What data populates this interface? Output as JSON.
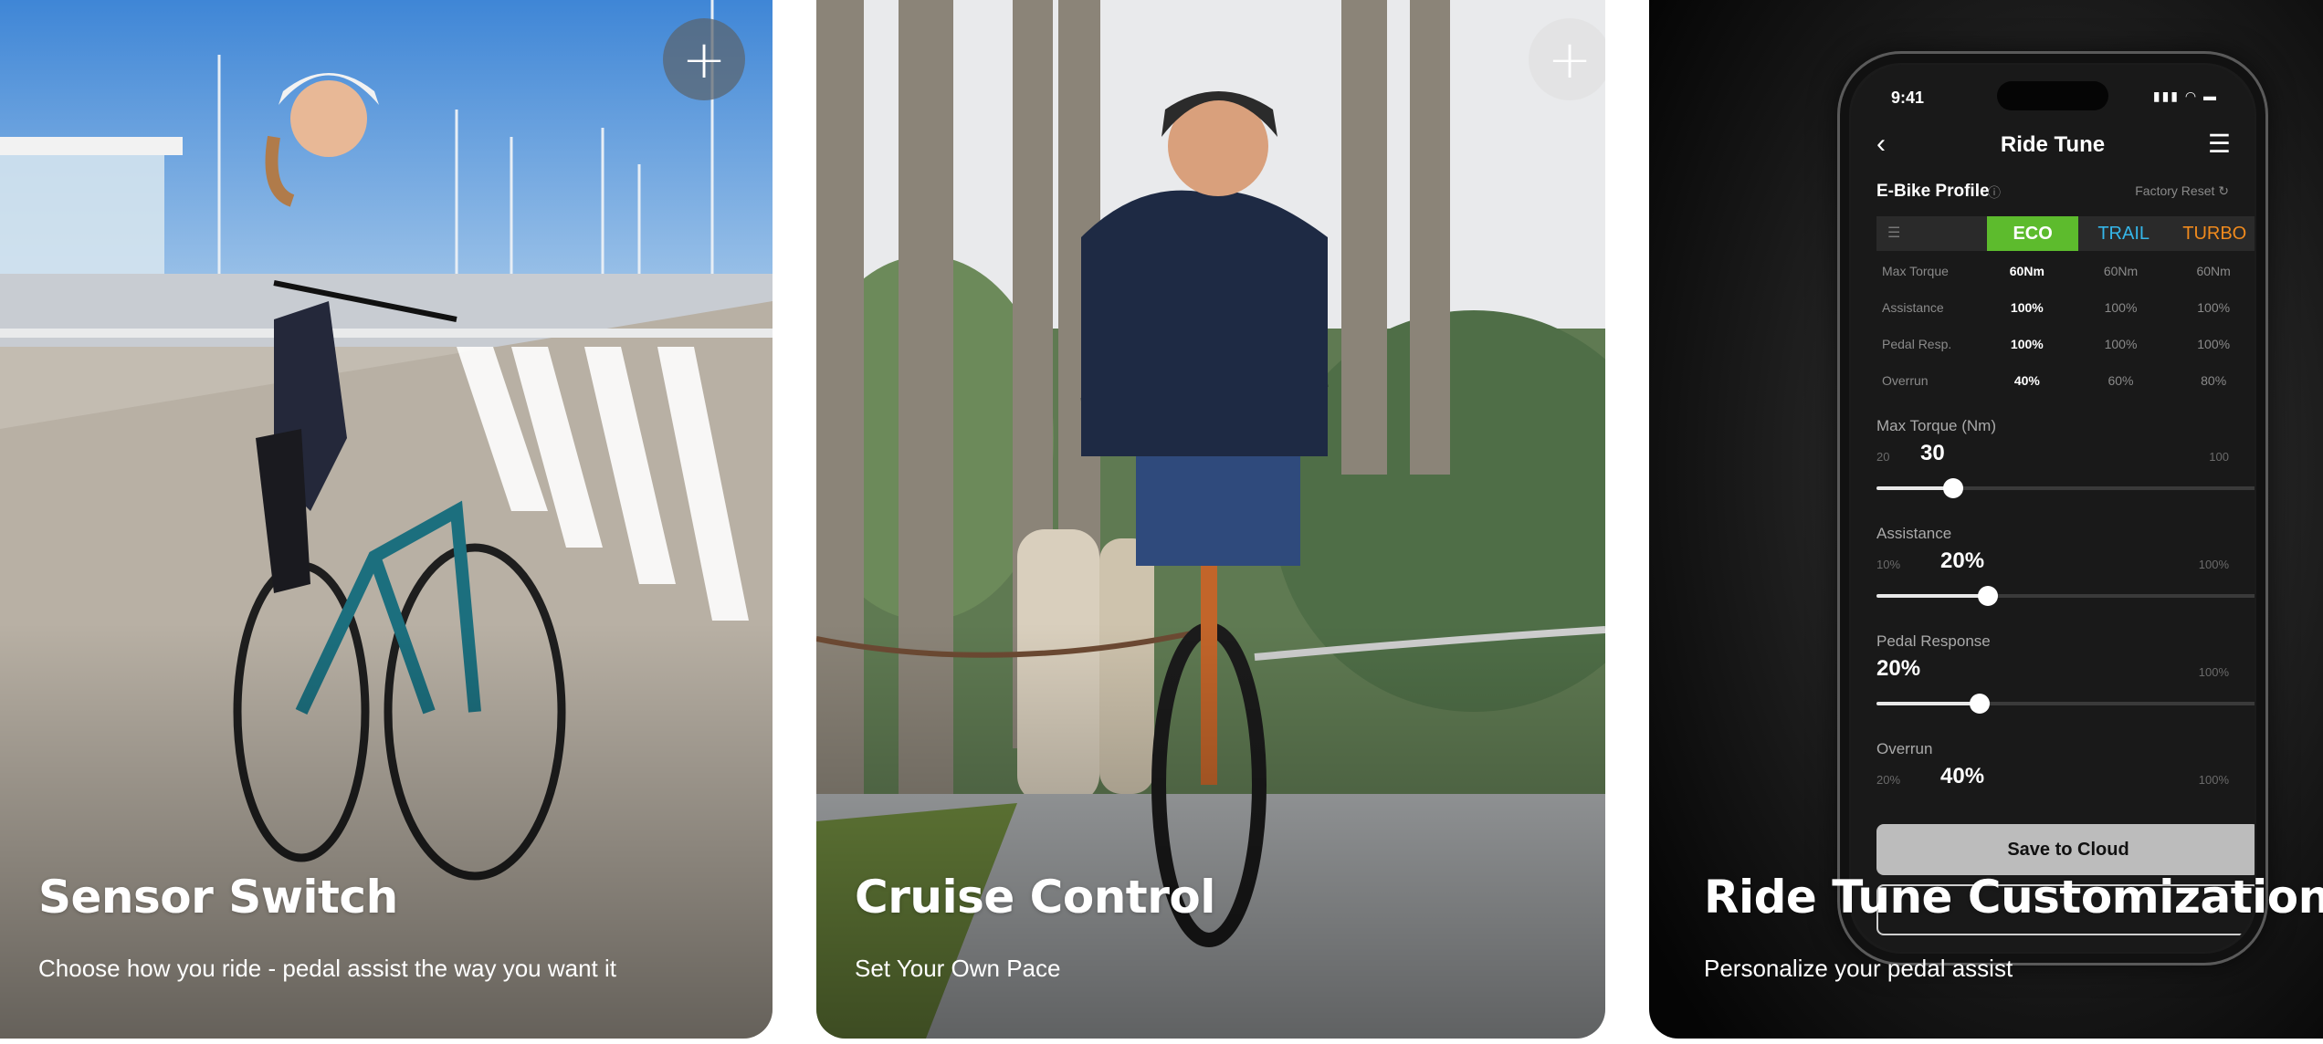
{
  "cards": [
    {
      "title": "Sensor Switch",
      "subtitle": "Choose how you ride - pedal assist the way you want it",
      "add_button": "+"
    },
    {
      "title": "Cruise Control",
      "subtitle": "Set Your Own Pace",
      "add_button": "+"
    },
    {
      "title": "Ride Tune Customization",
      "subtitle": "Personalize your pedal assist"
    }
  ],
  "phone": {
    "status_time": "9:41",
    "status_icons": "▮▮▮ ◠ ▬",
    "nav": {
      "back": "‹",
      "title": "Ride Tune",
      "menu": "☰"
    },
    "profile_title": "E-Bike Profile",
    "info_icon": "ⓘ",
    "factory_reset": "Factory Reset ↻",
    "tab_list_icon": "☰",
    "tabs": [
      "ECO",
      "TRAIL",
      "TURBO"
    ],
    "tab_colors": {
      "eco": "#5dbb2d",
      "trail": "#35b6e9",
      "turbo": "#f08a1d"
    },
    "rows": [
      {
        "label": "Max Torque",
        "values": [
          "60Nm",
          "60Nm",
          "60Nm"
        ]
      },
      {
        "label": "Assistance",
        "values": [
          "100%",
          "100%",
          "100%"
        ]
      },
      {
        "label": "Pedal Resp.",
        "values": [
          "100%",
          "100%",
          "100%"
        ]
      },
      {
        "label": "Overrun",
        "values": [
          "40%",
          "60%",
          "80%"
        ]
      }
    ],
    "sliders": [
      {
        "label": "Max Torque (Nm)",
        "min": "20",
        "max": "100",
        "value": "30",
        "fraction": 0.2
      },
      {
        "label": "Assistance",
        "min": "10%",
        "max": "100%",
        "value": "20%",
        "fraction": 0.29
      },
      {
        "label": "Pedal Response",
        "min": "",
        "max": "100%",
        "value": "20%",
        "fraction": 0.27
      },
      {
        "label": "Overrun",
        "min": "20%",
        "max": "100%",
        "value": "40%",
        "fraction": 0.29
      }
    ],
    "save_label": "Save to Cloud"
  }
}
